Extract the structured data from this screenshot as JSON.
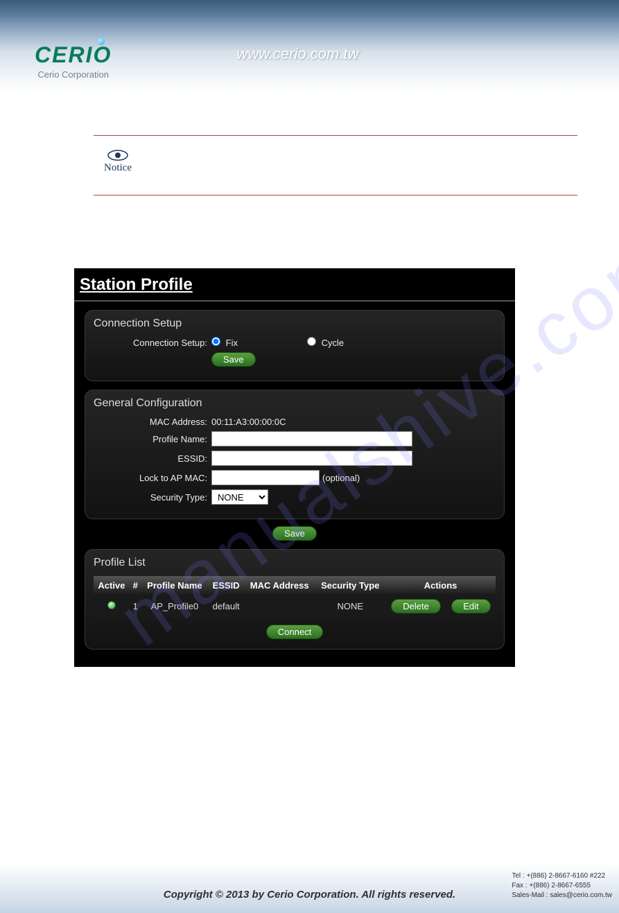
{
  "header": {
    "logo_main": "CERIO",
    "logo_sub": "Cerio Corporation",
    "url": "www.cerio.com.tw"
  },
  "notice": {
    "label": "Notice"
  },
  "panel": {
    "title": "Station Profile",
    "connection": {
      "legend": "Connection Setup",
      "label": "Connection Setup:",
      "fix": "Fix",
      "cycle": "Cycle",
      "save": "Save"
    },
    "general": {
      "legend": "General Configuration",
      "mac_label": "MAC Address:",
      "mac_value": "00:11:A3:00:00:0C",
      "profile_label": "Profile Name:",
      "profile_value": "",
      "essid_label": "ESSID:",
      "essid_value": "",
      "lock_label": "Lock to AP MAC:",
      "lock_value": "",
      "lock_optional": "(optional)",
      "security_label": "Security Type:",
      "security_value": "NONE",
      "save": "Save"
    },
    "list": {
      "legend": "Profile List",
      "headers": {
        "active": "Active",
        "num": "#",
        "name": "Profile Name",
        "essid": "ESSID",
        "mac": "MAC Address",
        "sec": "Security Type",
        "actions": "Actions"
      },
      "rows": [
        {
          "num": "1",
          "name": "AP_Profile0",
          "essid": "default",
          "mac": "",
          "sec": "NONE",
          "del": "Delete",
          "edit": "Edit"
        }
      ],
      "connect": "Connect"
    }
  },
  "footer": {
    "copyright": "Copyright © 2013 by Cerio Corporation. All rights reserved.",
    "tel": "Tel : +(886) 2-8667-6160 #222",
    "fax": "Fax : +(886) 2-8667-6555",
    "mail": "Sales-Mail : sales@cerio.com.tw"
  }
}
